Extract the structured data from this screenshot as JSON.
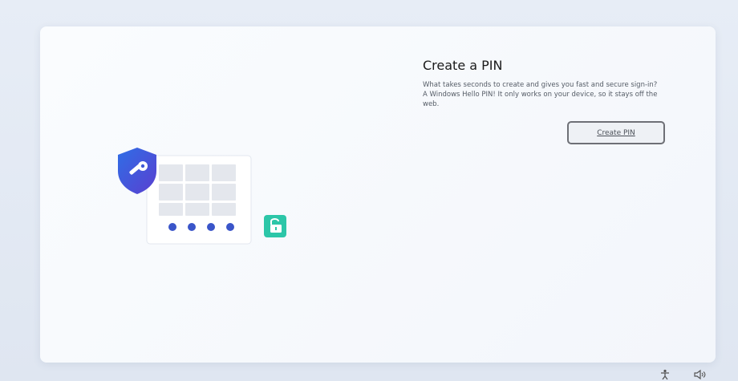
{
  "setup": {
    "title": "Create a PIN",
    "description": "What takes seconds to create and gives you fast and secure sign-in? A Windows Hello PIN! It only works on your device, so it stays off the web.",
    "create_pin_label": "Create PIN"
  },
  "icons": {
    "shield": "shield-key-icon",
    "keypad": "keypad-icon",
    "unlock": "unlock-icon",
    "accessibility": "accessibility-icon",
    "volume": "volume-icon"
  },
  "colors": {
    "shield_blue": "#3b57d6",
    "dot_blue": "#3a55c9",
    "unlock_teal": "#2cc6a8"
  }
}
